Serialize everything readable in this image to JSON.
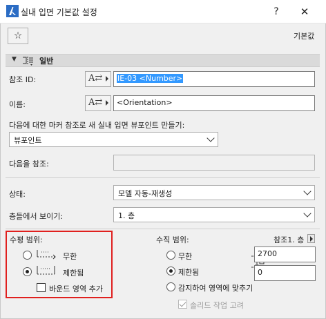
{
  "window": {
    "title": "실내 입면 기본값 설정",
    "help_label": "?",
    "close_label": "✕",
    "app_icon": "archicad-icon"
  },
  "toolbar": {
    "favorite_icon": "star-icon",
    "favorite_glyph": "☆",
    "default_label": "기본값"
  },
  "section": {
    "arrow": "▼",
    "icon": "elevation-section-icon",
    "title": "일반"
  },
  "fields": {
    "reference_id": {
      "label": "참조 ID:",
      "value": "IE-03 <Number>",
      "button_glyph": "A⇄"
    },
    "name": {
      "label": "이름:",
      "value": "<Orientation>",
      "button_glyph": "A⇄"
    },
    "create_viewpoint": {
      "label": "다음에 대한 마커 참조로 새 실내 입면 뷰포인트 만들기:",
      "value": "뷰포인트"
    },
    "refer_to": {
      "label": "다음을 참조:",
      "value": ""
    },
    "status": {
      "label": "상태:",
      "value": "모델 자동-재생성"
    },
    "show_on_stories": {
      "label": "층들에서 보이기:",
      "value": "1. 층"
    }
  },
  "horizontal_range": {
    "label": "수평 범위:",
    "options": [
      {
        "label": "무한",
        "selected": false
      },
      {
        "label": "제한됨",
        "selected": true
      }
    ],
    "add_bounding_label": "바운드 영역 추가",
    "add_bounding_checked": false
  },
  "vertical_range": {
    "label": "수직 범위:",
    "reference_label": "참조1. 층",
    "options": [
      {
        "label": "무한",
        "selected": false
      },
      {
        "label": "제한됨",
        "selected": true
      },
      {
        "label": "감지하여 영역에 맞추기",
        "selected": false
      }
    ],
    "top_value": "2700",
    "bottom_value": "0",
    "solid_operations_label": "솔리드 작업 고려",
    "solid_operations_checked": true
  }
}
